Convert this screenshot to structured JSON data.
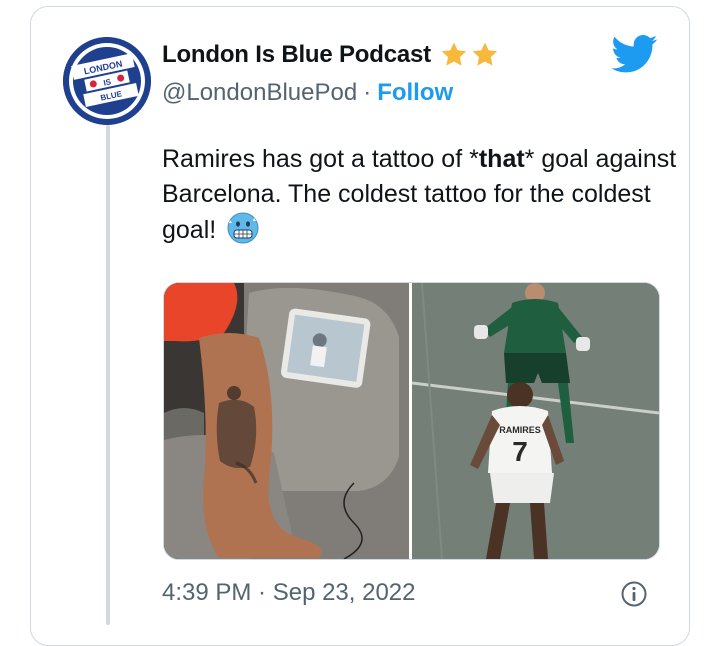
{
  "author": {
    "display_name": "London Is Blue Podcast",
    "handle": "@LondonBluePod",
    "follow_label": "Follow",
    "separator": "·",
    "avatar_text": {
      "line1": "LONDON",
      "line2": "IS",
      "line3": "BLUE"
    },
    "badges": [
      "star-emoji",
      "star-emoji"
    ]
  },
  "tweet": {
    "text_before": "Ramires has got a tattoo of *",
    "text_bold": "that",
    "text_after": "* goal against Barcelona. The coldest tattoo for the coldest goal! ",
    "emoji": "cold-face-emoji",
    "timestamp": "4:39 PM · Sep 23, 2022"
  },
  "media": {
    "left_image": "tattoo-leg-photo",
    "right_image": "football-match-photo",
    "jersey_name": "RAMIRES",
    "jersey_number": "7"
  },
  "colors": {
    "accent": "#1d9bf0",
    "secondary_text": "#536471",
    "border": "#cfd9de",
    "star": "#f6b93b"
  }
}
